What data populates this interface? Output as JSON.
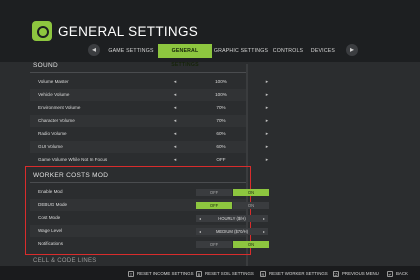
{
  "header": {
    "title": "GENERAL SETTINGS",
    "tabs": [
      {
        "label": "GAME SETTINGS",
        "active": false
      },
      {
        "label": "GENERAL SETTINGS",
        "active": true
      },
      {
        "label": "GRAPHIC SETTINGS",
        "active": false
      },
      {
        "label": "CONTROLS",
        "active": false
      },
      {
        "label": "DEVICES",
        "active": false
      }
    ],
    "prev_icon": "◂",
    "next_icon": "▸"
  },
  "sound": {
    "heading": "SOUND",
    "rows": [
      {
        "label": "Volume Master",
        "value": "100%"
      },
      {
        "label": "Vehicle Volume",
        "value": "100%"
      },
      {
        "label": "Environment Volume",
        "value": "70%"
      },
      {
        "label": "Character Volume",
        "value": "70%"
      },
      {
        "label": "Radio Volume",
        "value": "60%"
      },
      {
        "label": "GUI Volume",
        "value": "60%"
      },
      {
        "label": "Game Volume While Not In Focus",
        "value": "OFF"
      }
    ]
  },
  "worker_costs_mod": {
    "heading": "WORKER COSTS MOD",
    "rows": [
      {
        "label": "Enable Mod",
        "type": "toggle",
        "off": "OFF",
        "on": "ON",
        "selected": "ON"
      },
      {
        "label": "DEBUG Mode",
        "type": "toggle",
        "off": "OFF",
        "on": "ON",
        "selected": "OFF"
      },
      {
        "label": "Cost Mode",
        "type": "select",
        "value": "HOURLY ($/H)"
      },
      {
        "label": "Wage Level",
        "type": "select",
        "value": "MEDIUM ($70/H)"
      },
      {
        "label": "Notifications",
        "type": "toggle",
        "off": "OFF",
        "on": "ON",
        "selected": "ON"
      }
    ]
  },
  "next_section": "CELL & CODE LINES",
  "footer": {
    "hints": [
      {
        "key": "T",
        "label": "RESET INCOME SETTINGS"
      },
      {
        "key": "B",
        "label": "RESET SOIL SETTINGS"
      },
      {
        "key": "R",
        "label": "RESET WORKER SETTINGS"
      },
      {
        "key": "⎋",
        "label": "PREVIOUS MENU"
      },
      {
        "key": "↵",
        "label": "BACK"
      }
    ]
  },
  "colors": {
    "accent": "#8dc63f",
    "highlight_border": "#d92c2c",
    "background": "#2b2d2f",
    "header_bg": "#1d1f21"
  }
}
